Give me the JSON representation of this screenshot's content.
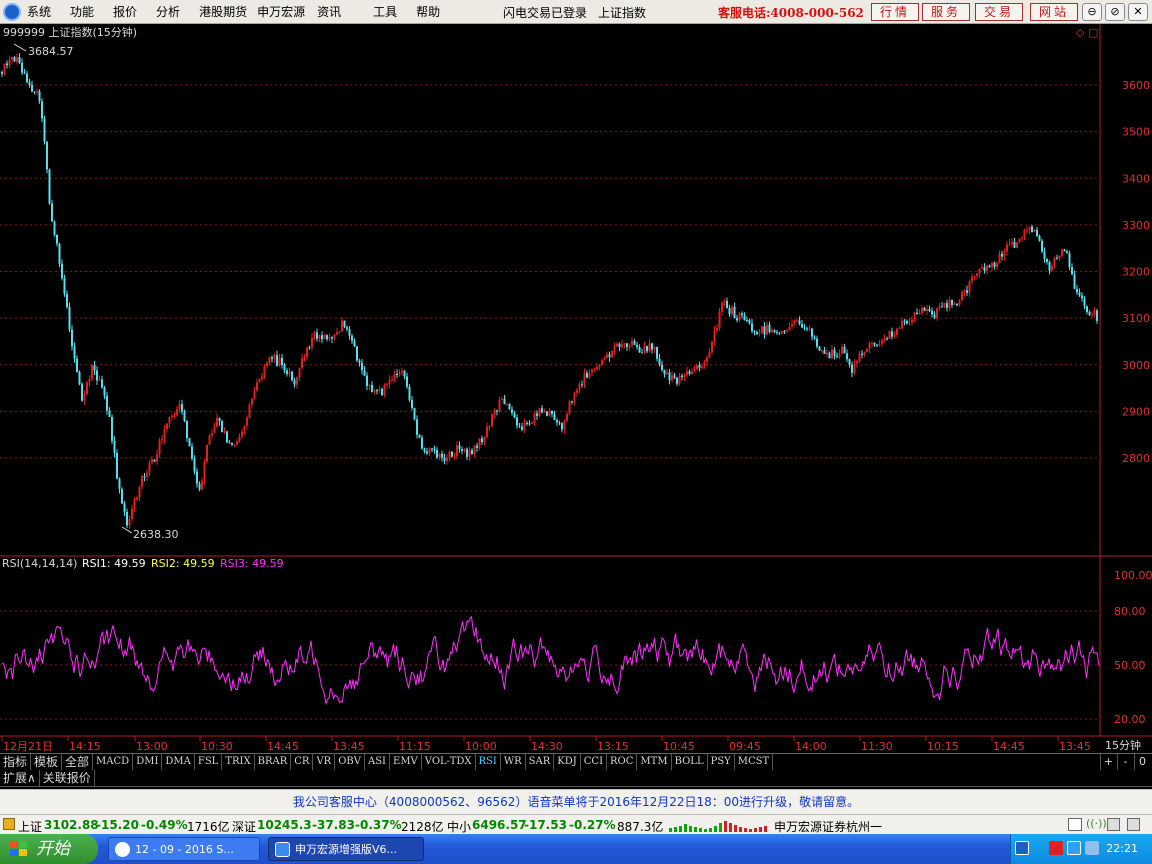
{
  "menu": {
    "items": [
      "系统",
      "功能",
      "报价",
      "分析",
      "港股期货",
      "申万宏源",
      "资讯",
      "工具",
      "帮助"
    ],
    "status": "闪电交易已登录",
    "current_symbol": "上证指数",
    "hotline": "客服电话:4008-000-562",
    "buttons": [
      "行情",
      "服务",
      "交易",
      "网站"
    ],
    "window_controls": [
      "⊖",
      "⊘",
      "🗗",
      "✕"
    ]
  },
  "chart": {
    "header": "999999 上证指数(15分钟)",
    "high_label": "3684.57",
    "low_label": "2638.30",
    "up_color": "#e02020",
    "down_color": "#55e0f0",
    "grid_color": "#8a1a1a"
  },
  "indicator": {
    "header": "RSI(14,14,14)",
    "rsi1_label": "RSI1: 49.59",
    "rsi2_label": "RSI2: 49.59",
    "rsi3_label": "RSI3: 49.59",
    "rsi1_color": "#ffffff",
    "rsi2_color": "#ffff40",
    "rsi3_color": "#ff30ff"
  },
  "time_axis": {
    "labels": [
      "12月21日",
      "14:15",
      "13:00",
      "10:30",
      "14:45",
      "13:45",
      "11:15",
      "10:00",
      "14:30",
      "13:15",
      "10:45",
      "09:45",
      "14:00",
      "11:30",
      "10:15",
      "14:45",
      "13:45"
    ],
    "period": "15分钟"
  },
  "tabs": {
    "items": [
      "指标",
      "模板",
      "全部",
      "MACD",
      "DMI",
      "DMA",
      "FSL",
      "TRIX",
      "BRAR",
      "CR",
      "VR",
      "OBV",
      "ASI",
      "EMV",
      "VOL-TDX",
      "RSI",
      "WR",
      "SAR",
      "KDJ",
      "CCI",
      "ROC",
      "MTM",
      "BOLL",
      "PSY",
      "MCST"
    ],
    "active": "RSI",
    "controls": [
      "+",
      "-",
      "0"
    ]
  },
  "subtabs": [
    "扩展∧",
    "关联报价"
  ],
  "notice": "我公司客服中心（4008000562、96562）语音菜单将于2016年12月22日18：00进行升级，敬请留意。",
  "quotes": {
    "sh_name": "上证",
    "sh_price": "3102.88",
    "sh_change": "-15.20",
    "sh_pct": "-0.49%",
    "sh_amount": "1716亿",
    "sz_name": "深证",
    "sz_price": "10245.3",
    "sz_change": "-37.83",
    "sz_pct": "-0.37%",
    "sz_amount": "2128亿",
    "zx_name": "中小",
    "zx_price": "6496.57",
    "zx_change": "-17.53",
    "zx_pct": "-0.27%",
    "zx_amount": "887.3亿",
    "broker": "申万宏源证券杭州一"
  },
  "taskbar": {
    "start": "开始",
    "tasks": [
      "12 - 09 - 2016 S...",
      "申万宏源增强版V6..."
    ],
    "clock": "22:21"
  },
  "chart_data": [
    {
      "type": "candlestick",
      "title": "999999 上证指数(15分钟)",
      "y_ticks": [
        2800,
        2900,
        3000,
        3100,
        3200,
        3300,
        3400,
        3500,
        3600
      ],
      "ylim": [
        2600,
        3720
      ],
      "high": 3684.57,
      "low": 2638.3,
      "trend_points": [
        [
          0,
          3620
        ],
        [
          10,
          3660
        ],
        [
          18,
          3650
        ],
        [
          28,
          3600
        ],
        [
          38,
          3580
        ],
        [
          44,
          3500
        ],
        [
          50,
          3320
        ],
        [
          58,
          3240
        ],
        [
          66,
          3130
        ],
        [
          74,
          3020
        ],
        [
          82,
          2930
        ],
        [
          92,
          2990
        ],
        [
          102,
          2950
        ],
        [
          110,
          2880
        ],
        [
          118,
          2740
        ],
        [
          126,
          2660
        ],
        [
          134,
          2700
        ],
        [
          142,
          2760
        ],
        [
          152,
          2790
        ],
        [
          162,
          2840
        ],
        [
          172,
          2890
        ],
        [
          182,
          2910
        ],
        [
          192,
          2790
        ],
        [
          200,
          2720
        ],
        [
          208,
          2850
        ],
        [
          218,
          2880
        ],
        [
          228,
          2840
        ],
        [
          238,
          2830
        ],
        [
          248,
          2900
        ],
        [
          258,
          2960
        ],
        [
          270,
          3020
        ],
        [
          282,
          3000
        ],
        [
          294,
          2960
        ],
        [
          306,
          3030
        ],
        [
          318,
          3070
        ],
        [
          330,
          3050
        ],
        [
          342,
          3090
        ],
        [
          352,
          3060
        ],
        [
          362,
          2980
        ],
        [
          372,
          2950
        ],
        [
          382,
          2940
        ],
        [
          392,
          2970
        ],
        [
          402,
          2990
        ],
        [
          410,
          2930
        ],
        [
          418,
          2840
        ],
        [
          426,
          2820
        ],
        [
          436,
          2810
        ],
        [
          446,
          2800
        ],
        [
          458,
          2820
        ],
        [
          470,
          2810
        ],
        [
          482,
          2840
        ],
        [
          494,
          2900
        ],
        [
          506,
          2930
        ],
        [
          518,
          2860
        ],
        [
          530,
          2880
        ],
        [
          542,
          2900
        ],
        [
          552,
          2890
        ],
        [
          562,
          2870
        ],
        [
          572,
          2930
        ],
        [
          584,
          2970
        ],
        [
          596,
          3000
        ],
        [
          608,
          3020
        ],
        [
          620,
          3040
        ],
        [
          632,
          3050
        ],
        [
          644,
          3030
        ],
        [
          654,
          3040
        ],
        [
          664,
          2980
        ],
        [
          676,
          2960
        ],
        [
          688,
          2980
        ],
        [
          700,
          3000
        ],
        [
          712,
          3040
        ],
        [
          722,
          3130
        ],
        [
          734,
          3110
        ],
        [
          746,
          3090
        ],
        [
          758,
          3070
        ],
        [
          770,
          3080
        ],
        [
          782,
          3070
        ],
        [
          794,
          3090
        ],
        [
          806,
          3080
        ],
        [
          818,
          3040
        ],
        [
          830,
          3020
        ],
        [
          842,
          3030
        ],
        [
          852,
          2990
        ],
        [
          864,
          3030
        ],
        [
          876,
          3050
        ],
        [
          888,
          3060
        ],
        [
          900,
          3080
        ],
        [
          912,
          3100
        ],
        [
          924,
          3120
        ],
        [
          936,
          3110
        ],
        [
          948,
          3130
        ],
        [
          960,
          3140
        ],
        [
          972,
          3180
        ],
        [
          984,
          3210
        ],
        [
          996,
          3220
        ],
        [
          1008,
          3250
        ],
        [
          1020,
          3270
        ],
        [
          1030,
          3300
        ],
        [
          1040,
          3260
        ],
        [
          1050,
          3210
        ],
        [
          1060,
          3240
        ],
        [
          1068,
          3230
        ],
        [
          1076,
          3150
        ],
        [
          1086,
          3120
        ],
        [
          1098,
          3100
        ]
      ]
    },
    {
      "type": "line",
      "title": "RSI(14,14,14)",
      "y_ticks": [
        20,
        50,
        80,
        100
      ],
      "ylim": [
        15,
        105
      ],
      "last_values": {
        "RSI1": 49.59,
        "RSI2": 49.59,
        "RSI3": 49.59
      }
    }
  ]
}
